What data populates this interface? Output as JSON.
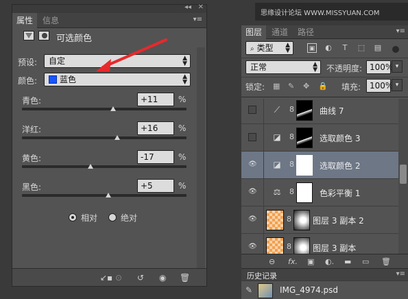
{
  "watermark": "思缘设计论坛 WWW.MISSYUAN.COM",
  "properties": {
    "tabs": [
      "属性",
      "信息"
    ],
    "title": "可选颜色",
    "preset_label": "预设:",
    "preset_value": "自定",
    "colors_label": "颜色:",
    "colors_value": "蓝色",
    "swatch_color": "#1756ff",
    "sliders": [
      {
        "label": "青色:",
        "value": "+11",
        "unit": "%",
        "level": 11
      },
      {
        "label": "洋红:",
        "value": "+16",
        "unit": "%",
        "level": 16
      },
      {
        "label": "黄色:",
        "value": "-17",
        "unit": "%",
        "level": -17
      },
      {
        "label": "黑色:",
        "value": "+5",
        "unit": "%",
        "level": 5
      }
    ],
    "radio_relative": "相对",
    "radio_absolute": "绝对",
    "method_selected": "相对"
  },
  "layers_panel": {
    "tabs": [
      "图层",
      "通道",
      "路径"
    ],
    "filter_label": "类型",
    "blend_mode": "正常",
    "opacity_label": "不透明度:",
    "opacity_value": "100%",
    "lock_label": "锁定:",
    "fill_label": "填充:",
    "fill_value": "100%",
    "layers": [
      {
        "name": "曲线 7",
        "visible": false,
        "adj_icon": "curves-icon",
        "selected": false
      },
      {
        "name": "选取颜色 3",
        "visible": false,
        "adj_icon": "selective-color-icon",
        "selected": false
      },
      {
        "name": "选取颜色 2",
        "visible": true,
        "adj_icon": "selective-color-icon",
        "selected": true
      },
      {
        "name": "色彩平衡 1",
        "visible": true,
        "adj_icon": "color-balance-icon",
        "selected": false
      },
      {
        "name": "图层 3 副本 2",
        "visible": true,
        "adj_icon": "",
        "selected": false
      },
      {
        "name": "图层 3 副本",
        "visible": true,
        "adj_icon": "",
        "selected": false
      }
    ]
  },
  "history": {
    "tab": "历史记录",
    "item": "IMG_4974.psd"
  }
}
